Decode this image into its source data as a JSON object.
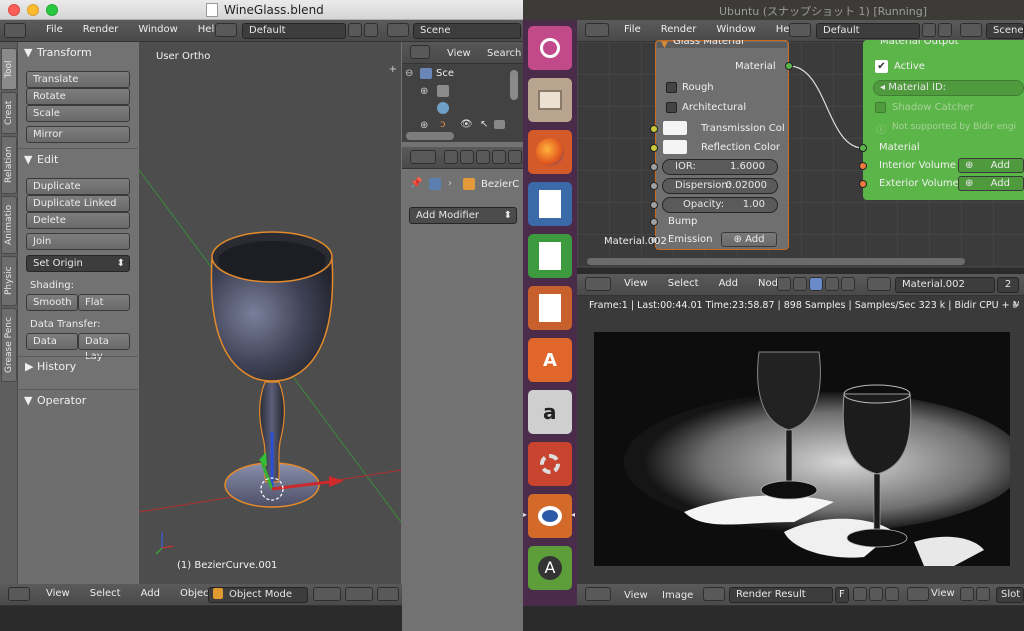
{
  "mac_window": {
    "title": "WineGlass.blend"
  },
  "ubuntu_window": {
    "title": "Ubuntu (スナップショット 1) [Running]"
  },
  "top_header": {
    "menus": [
      "File",
      "Render",
      "Window",
      "Help"
    ],
    "layout": "Default",
    "scene": "Scene"
  },
  "tool_tabs": [
    "Tool",
    "Creat",
    "Relation",
    "Animatio",
    "Physic",
    "Grease Penc"
  ],
  "tool_panel": {
    "transform": {
      "title": "Transform",
      "buttons": [
        "Translate",
        "Rotate",
        "Scale",
        "Mirror"
      ]
    },
    "edit": {
      "title": "Edit",
      "buttons": [
        "Duplicate",
        "Duplicate Linked",
        "Delete",
        "Join"
      ],
      "set_origin": "Set Origin"
    },
    "shading": {
      "label": "Shading:",
      "smooth": "Smooth",
      "flat": "Flat"
    },
    "data_transfer": {
      "label": "Data Transfer:",
      "data": "Data",
      "data_lay": "Data Lay"
    },
    "history": "History",
    "operator": "Operator"
  },
  "viewport": {
    "view_label": "User Ortho",
    "object_label": "(1) BezierCurve.001"
  },
  "viewport_header": {
    "menus": [
      "View",
      "Select",
      "Add",
      "Object"
    ],
    "mode": "Object Mode"
  },
  "outliner": {
    "menus": [
      "View",
      "Search"
    ],
    "scene": "Sce"
  },
  "properties": {
    "object": "BezierC",
    "add_modifier": "Add Modifier"
  },
  "guest_header": {
    "menus": [
      "File",
      "Render",
      "Window",
      "Help"
    ],
    "layout": "Default",
    "scene": "Scene"
  },
  "glass_node": {
    "title": "Glass Material",
    "output": "Material",
    "rough": "Rough",
    "architectural": "Architectural",
    "transmission": "Transmission Col",
    "reflection": "Reflection Color",
    "ior_label": "IOR:",
    "ior_value": "1.6000",
    "dispersion_label": "Dispersion:",
    "dispersion_value": "0.02000",
    "opacity_label": "Opacity:",
    "opacity_value": "1.00",
    "bump": "Bump",
    "emission": "Emission",
    "add": "Add"
  },
  "output_node": {
    "title": "Material Output",
    "active": "Active",
    "material_id": "Material ID:",
    "shadow_catcher": "Shadow Catcher",
    "note": "Not supported by Bidir engi",
    "material": "Material",
    "interior": "Interior Volume",
    "exterior": "Exterior Volume",
    "add": "Add"
  },
  "node_label": "Material.002",
  "node_header": {
    "menus": [
      "View",
      "Select",
      "Add",
      "Node"
    ],
    "material": "Material.002",
    "users": "2"
  },
  "render_info": "Frame:1 | Last:00:44.01 Time:23:58.87 | 898 Samples | Samples/Sec 323 k | Bidir CPU + Metropol",
  "image_header": {
    "menus": [
      "View",
      "Image"
    ],
    "image_name": "Render Result",
    "f": "F",
    "view": "View",
    "slot": "Slot"
  },
  "colors": {
    "node_green": "#5cb548",
    "output_socket": "#f07a3c",
    "color_socket": "#c8c83a",
    "launcher_bg": "#4a2b4a"
  },
  "launcher_icons": [
    "ubuntu-dash-icon",
    "files-icon",
    "firefox-icon",
    "writer-icon",
    "calc-icon",
    "impress-icon",
    "software-center-icon",
    "amazon-icon",
    "settings-icon",
    "blender-icon",
    "updater-icon"
  ]
}
